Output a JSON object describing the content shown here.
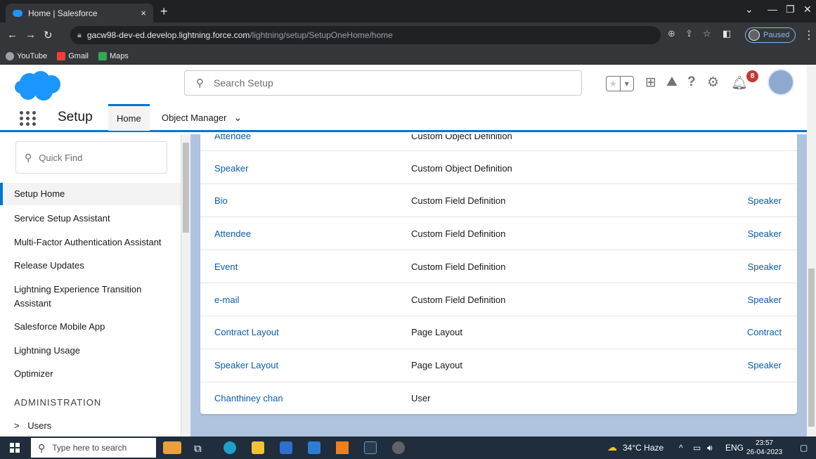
{
  "browser": {
    "tab_title": "Home | Salesforce",
    "tab_close": "×",
    "new_tab": "+",
    "url_host": "gacw98-dev-ed.develop.lightning.force.com",
    "url_path": "/lightning/setup/SetupOneHome/home",
    "profile_status": "Paused",
    "bookmarks": [
      {
        "label": "YouTube",
        "color": "#ffffff"
      },
      {
        "label": "Gmail",
        "color": "#ea4335"
      },
      {
        "label": "Maps",
        "color": "#34a853"
      }
    ]
  },
  "header": {
    "search_placeholder": "Search Setup",
    "notification_count": "8",
    "help_glyph": "?"
  },
  "context": {
    "app_name": "Setup",
    "tabs": [
      {
        "label": "Home"
      },
      {
        "label": "Object Manager"
      }
    ],
    "tab_chevron": "⌄"
  },
  "sidebar": {
    "quick_find_placeholder": "Quick Find",
    "items": [
      {
        "label": "Setup Home"
      },
      {
        "label": "Service Setup Assistant"
      },
      {
        "label": "Multi-Factor Authentication Assistant"
      },
      {
        "label": "Release Updates"
      },
      {
        "label": "Lightning Experience Transition\nAssistant"
      },
      {
        "label": "Salesforce Mobile App"
      },
      {
        "label": "Lightning Usage"
      },
      {
        "label": "Optimizer"
      }
    ],
    "section_header": "ADMINISTRATION",
    "section_items": [
      {
        "label": "Users",
        "chevron": ">"
      }
    ]
  },
  "results": {
    "rows": [
      {
        "name": "Attendee",
        "type": "Custom Object Definition",
        "object": ""
      },
      {
        "name": "Speaker",
        "type": "Custom Object Definition",
        "object": ""
      },
      {
        "name": "Bio",
        "type": "Custom Field Definition",
        "object": "Speaker"
      },
      {
        "name": "Attendee",
        "type": "Custom Field Definition",
        "object": "Speaker"
      },
      {
        "name": "Event",
        "type": "Custom Field Definition",
        "object": "Speaker"
      },
      {
        "name": "e-mail",
        "type": "Custom Field Definition",
        "object": "Speaker"
      },
      {
        "name": "Contract Layout",
        "type": "Page Layout",
        "object": "Contract"
      },
      {
        "name": "Speaker Layout",
        "type": "Page Layout",
        "object": "Speaker"
      },
      {
        "name": "Chanthiney chan",
        "type": "User",
        "object": ""
      }
    ]
  },
  "taskbar": {
    "search_placeholder": "Type here to search",
    "weather": "34°C Haze",
    "language": "ENG",
    "time": "23:57",
    "date": "26-04-2023"
  },
  "colors": {
    "brand_blue": "#0176d3",
    "link_blue": "#0b5cab",
    "cloud_blue": "#1b96ff",
    "badge_red": "#c23934"
  }
}
